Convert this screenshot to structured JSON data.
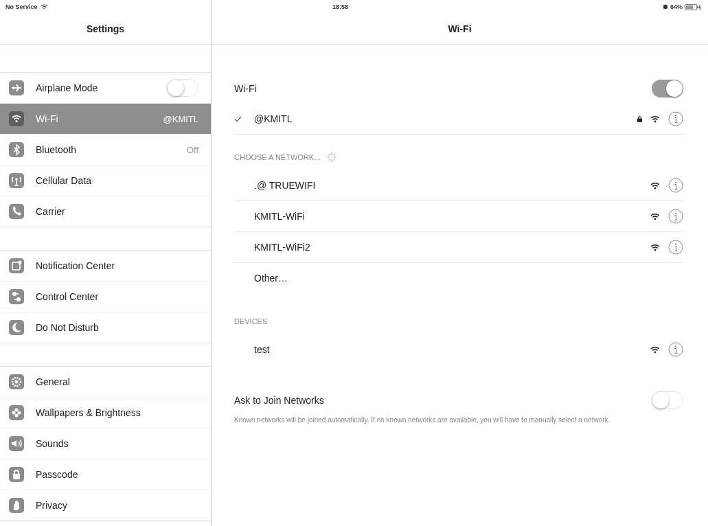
{
  "status_bar": {
    "carrier": "No Service",
    "time": "18:58",
    "battery": "64%"
  },
  "sidebar": {
    "title": "Settings",
    "groups": [
      {
        "items": [
          {
            "label": "Airplane Mode",
            "kind": "toggle",
            "on": false,
            "selected": false
          },
          {
            "label": "Wi-Fi",
            "kind": "value",
            "value": "@KMITL",
            "selected": true
          },
          {
            "label": "Bluetooth",
            "kind": "value",
            "value": "Off",
            "selected": false
          },
          {
            "label": "Cellular Data",
            "kind": "plain",
            "selected": false
          },
          {
            "label": "Carrier",
            "kind": "plain",
            "selected": false
          }
        ]
      },
      {
        "items": [
          {
            "label": "Notification Center",
            "kind": "plain",
            "selected": false
          },
          {
            "label": "Control Center",
            "kind": "plain",
            "selected": false
          },
          {
            "label": "Do Not Disturb",
            "kind": "plain",
            "selected": false
          }
        ]
      },
      {
        "items": [
          {
            "label": "General",
            "kind": "plain",
            "selected": false
          },
          {
            "label": "Wallpapers & Brightness",
            "kind": "plain",
            "selected": false
          },
          {
            "label": "Sounds",
            "kind": "plain",
            "selected": false
          },
          {
            "label": "Passcode",
            "kind": "plain",
            "selected": false
          },
          {
            "label": "Privacy",
            "kind": "plain",
            "selected": false
          }
        ]
      }
    ]
  },
  "detail": {
    "title": "Wi-Fi",
    "wifi_toggle": {
      "label": "Wi-Fi",
      "on": true
    },
    "connected": {
      "name": "@KMITL",
      "checked": true,
      "locked": true
    },
    "networks_header": "CHOOSE A NETWORK...",
    "networks": [
      {
        "name": ".@  TRUEWIFI",
        "locked": false
      },
      {
        "name": "KMITL-WiFi",
        "locked": false
      },
      {
        "name": "KMITL-WiFi2",
        "locked": false
      }
    ],
    "other": "Other…",
    "devices_header": "DEVICES",
    "devices": [
      {
        "name": "test"
      }
    ],
    "ask_to_join": {
      "label": "Ask to Join Networks",
      "on": false
    },
    "footnote": "Known networks will be joined automatically. If no known networks are available, you will have to manually select a network."
  }
}
